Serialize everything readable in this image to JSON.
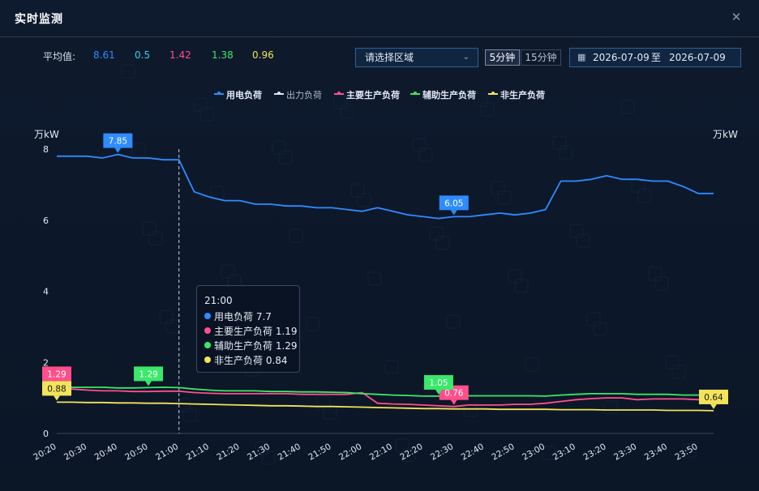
{
  "window": {
    "title": "实时监测",
    "close_icon": "close-icon"
  },
  "averages": {
    "label": "平均值:",
    "items": [
      {
        "value": "8.61",
        "color": "#2f8cff"
      },
      {
        "value": "0.5",
        "color": "#35d0e6"
      },
      {
        "value": "1.42",
        "color": "#ff4f8b"
      },
      {
        "value": "1.38",
        "color": "#39e96a"
      },
      {
        "value": "0.96",
        "color": "#f3e35a"
      }
    ]
  },
  "controls": {
    "region_placeholder": "请选择区域",
    "interval_options": [
      "5分钟",
      "15分钟"
    ],
    "interval_selected": "5分钟",
    "date_from": "2026-07-09",
    "date_sep": "至",
    "date_to": "2026-07-09"
  },
  "tooltip": {
    "time": "21:00",
    "rows": [
      {
        "text": "用电负荷 7.7",
        "color": "#2f8cff"
      },
      {
        "text": "主要生产负荷 1.19",
        "color": "#ff4f8b"
      },
      {
        "text": "辅助生产负荷 1.29",
        "color": "#39e96a"
      },
      {
        "text": "非生产负荷 0.84",
        "color": "#f3e35a"
      }
    ]
  },
  "chart_data": {
    "type": "line",
    "ylabel": "万kW",
    "ylabel_right": "万kW",
    "ylim": [
      0,
      8
    ],
    "yticks": [
      0,
      2,
      4,
      6,
      8
    ],
    "grid": false,
    "legend_position": "top-center",
    "x_tick_labels": [
      "20:20",
      "20:30",
      "20:40",
      "20:50",
      "21:00",
      "21:10",
      "21:20",
      "21:30",
      "21:40",
      "21:50",
      "22:00",
      "22:10",
      "22:20",
      "22:30",
      "22:40",
      "22:50",
      "23:00",
      "23:10",
      "23:20",
      "23:30",
      "23:40",
      "23:50"
    ],
    "x": [
      "20:20",
      "20:25",
      "20:30",
      "20:35",
      "20:40",
      "20:45",
      "20:50",
      "20:55",
      "21:00",
      "21:05",
      "21:10",
      "21:15",
      "21:20",
      "21:25",
      "21:30",
      "21:35",
      "21:40",
      "21:45",
      "21:50",
      "21:55",
      "22:00",
      "22:05",
      "22:10",
      "22:15",
      "22:20",
      "22:25",
      "22:30",
      "22:35",
      "22:40",
      "22:45",
      "22:50",
      "22:55",
      "23:00",
      "23:05",
      "23:10",
      "23:15",
      "23:20",
      "23:25",
      "23:30",
      "23:35",
      "23:40",
      "23:45",
      "23:50",
      "23:55"
    ],
    "crosshair_x": "21:00",
    "series": [
      {
        "name": "用电负荷",
        "color": "#2f8cff",
        "values": [
          7.8,
          7.8,
          7.8,
          7.75,
          7.85,
          7.75,
          7.75,
          7.7,
          7.7,
          6.8,
          6.65,
          6.55,
          6.55,
          6.45,
          6.45,
          6.4,
          6.4,
          6.35,
          6.35,
          6.3,
          6.25,
          6.35,
          6.25,
          6.15,
          6.1,
          6.05,
          6.1,
          6.1,
          6.15,
          6.2,
          6.15,
          6.2,
          6.3,
          7.1,
          7.1,
          7.15,
          7.25,
          7.15,
          7.15,
          7.1,
          7.1,
          6.95,
          6.75,
          6.75
        ],
        "marker": {
          "x": "20:40",
          "label": "7.85"
        },
        "marker2": {
          "x": "22:30",
          "label": "6.05"
        }
      },
      {
        "name": "出力负荷",
        "color": "#dfe6f0",
        "values": []
      },
      {
        "name": "主要生产负荷",
        "color": "#ff4f8b",
        "values": [
          1.29,
          1.25,
          1.22,
          1.2,
          1.2,
          1.18,
          1.18,
          1.19,
          1.19,
          1.15,
          1.13,
          1.12,
          1.12,
          1.12,
          1.12,
          1.12,
          1.1,
          1.1,
          1.1,
          1.1,
          1.15,
          0.85,
          0.83,
          0.82,
          0.8,
          0.78,
          0.76,
          0.8,
          0.8,
          0.8,
          0.82,
          0.82,
          0.85,
          0.9,
          0.95,
          0.98,
          1.0,
          1.0,
          0.95,
          0.97,
          0.97,
          0.97,
          0.95,
          1.0
        ],
        "marker": {
          "x": "20:20",
          "label": "1.29"
        },
        "marker2": {
          "x": "22:30",
          "label": "0.76"
        }
      },
      {
        "name": "辅助生产负荷",
        "color": "#39e96a",
        "values": [
          1.3,
          1.3,
          1.3,
          1.3,
          1.28,
          1.28,
          1.29,
          1.3,
          1.29,
          1.25,
          1.22,
          1.2,
          1.2,
          1.2,
          1.18,
          1.18,
          1.17,
          1.17,
          1.16,
          1.15,
          1.12,
          1.1,
          1.08,
          1.07,
          1.05,
          1.05,
          1.04,
          1.06,
          1.06,
          1.06,
          1.06,
          1.06,
          1.05,
          1.08,
          1.1,
          1.12,
          1.12,
          1.12,
          1.1,
          1.1,
          1.1,
          1.08,
          1.08,
          1.1
        ],
        "marker": {
          "x": "20:50",
          "label": "1.29"
        },
        "marker2": {
          "x": "22:25",
          "label": "1.05"
        }
      },
      {
        "name": "非生产负荷",
        "color": "#f3e35a",
        "values": [
          0.88,
          0.88,
          0.87,
          0.87,
          0.86,
          0.86,
          0.85,
          0.85,
          0.84,
          0.83,
          0.82,
          0.81,
          0.8,
          0.79,
          0.78,
          0.78,
          0.77,
          0.76,
          0.76,
          0.75,
          0.74,
          0.73,
          0.72,
          0.71,
          0.7,
          0.7,
          0.69,
          0.69,
          0.69,
          0.68,
          0.68,
          0.68,
          0.68,
          0.67,
          0.67,
          0.67,
          0.66,
          0.66,
          0.66,
          0.66,
          0.65,
          0.65,
          0.65,
          0.64
        ],
        "marker": {
          "x": "20:20",
          "label": "0.88"
        },
        "marker2": {
          "x": "23:55",
          "label": "0.64"
        }
      }
    ]
  }
}
